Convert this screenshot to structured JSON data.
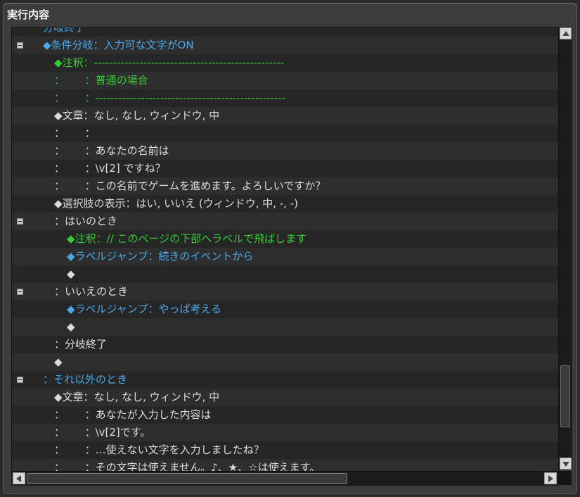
{
  "window": {
    "title": "実行内容"
  },
  "colors": {
    "white": "#dcdcdc",
    "blue": "#4aa8e8",
    "green": "#33cc33"
  },
  "rows": [
    {
      "indent": 44,
      "fold": false,
      "color": "blue",
      "text": "分岐終了"
    },
    {
      "indent": 44,
      "fold": true,
      "color": "blue",
      "text": "◆条件分岐：入力可な文字がON"
    },
    {
      "indent": 60,
      "fold": false,
      "color": "green",
      "text": "◆注釈：--------------------------------------------------"
    },
    {
      "indent": 60,
      "fold": false,
      "color": "green",
      "text": "：      ：普通の場合"
    },
    {
      "indent": 60,
      "fold": false,
      "color": "green",
      "text": "：      ：--------------------------------------------------"
    },
    {
      "indent": 60,
      "fold": false,
      "color": "white",
      "text": "◆文章：なし, なし, ウィンドウ, 中"
    },
    {
      "indent": 60,
      "fold": false,
      "color": "white",
      "text": "：      ："
    },
    {
      "indent": 60,
      "fold": false,
      "color": "white",
      "text": "：      ：あなたの名前は"
    },
    {
      "indent": 60,
      "fold": false,
      "color": "white",
      "text": "：      ：\\v[2] ですね？"
    },
    {
      "indent": 60,
      "fold": false,
      "color": "white",
      "text": "：      ：この名前でゲームを進めます。よろしいですか？"
    },
    {
      "indent": 60,
      "fold": false,
      "color": "white",
      "text": "◆選択肢の表示：はい, いいえ (ウィンドウ, 中, -, -)"
    },
    {
      "indent": 60,
      "fold": true,
      "color": "white",
      "text": "：はいのとき"
    },
    {
      "indent": 78,
      "fold": false,
      "color": "green",
      "text": "◆注釈：// このページの下部へラベルで飛ばします"
    },
    {
      "indent": 78,
      "fold": false,
      "color": "blue",
      "text": "◆ラベルジャンプ：続きのイベントから"
    },
    {
      "indent": 78,
      "fold": false,
      "color": "white",
      "text": "◆"
    },
    {
      "indent": 60,
      "fold": true,
      "color": "white",
      "text": "：いいえのとき"
    },
    {
      "indent": 78,
      "fold": false,
      "color": "blue",
      "text": "◆ラベルジャンプ：やっぱ考える"
    },
    {
      "indent": 78,
      "fold": false,
      "color": "white",
      "text": "◆"
    },
    {
      "indent": 60,
      "fold": false,
      "color": "white",
      "text": "：分岐終了"
    },
    {
      "indent": 60,
      "fold": false,
      "color": "white",
      "text": "◆"
    },
    {
      "indent": 44,
      "fold": true,
      "color": "blue",
      "text": "：それ以外のとき"
    },
    {
      "indent": 60,
      "fold": false,
      "color": "white",
      "text": "◆文章：なし, なし, ウィンドウ, 中"
    },
    {
      "indent": 60,
      "fold": false,
      "color": "white",
      "text": "：      ：あなたが入力した内容は"
    },
    {
      "indent": 60,
      "fold": false,
      "color": "white",
      "text": "：      ：\\v[2]です。"
    },
    {
      "indent": 60,
      "fold": false,
      "color": "white",
      "text": "：      ：…使えない文字を入力しましたね？"
    },
    {
      "indent": 60,
      "fold": false,
      "color": "white",
      "text": "：      ：その文字は使えません。♪、★、☆は使えます。"
    }
  ],
  "scrollbars": {
    "vertical": {
      "up_icon": "arrow-up-icon",
      "down_icon": "arrow-down-icon"
    },
    "horizontal": {
      "left_icon": "arrow-left-icon",
      "right_icon": "arrow-right-icon"
    }
  }
}
